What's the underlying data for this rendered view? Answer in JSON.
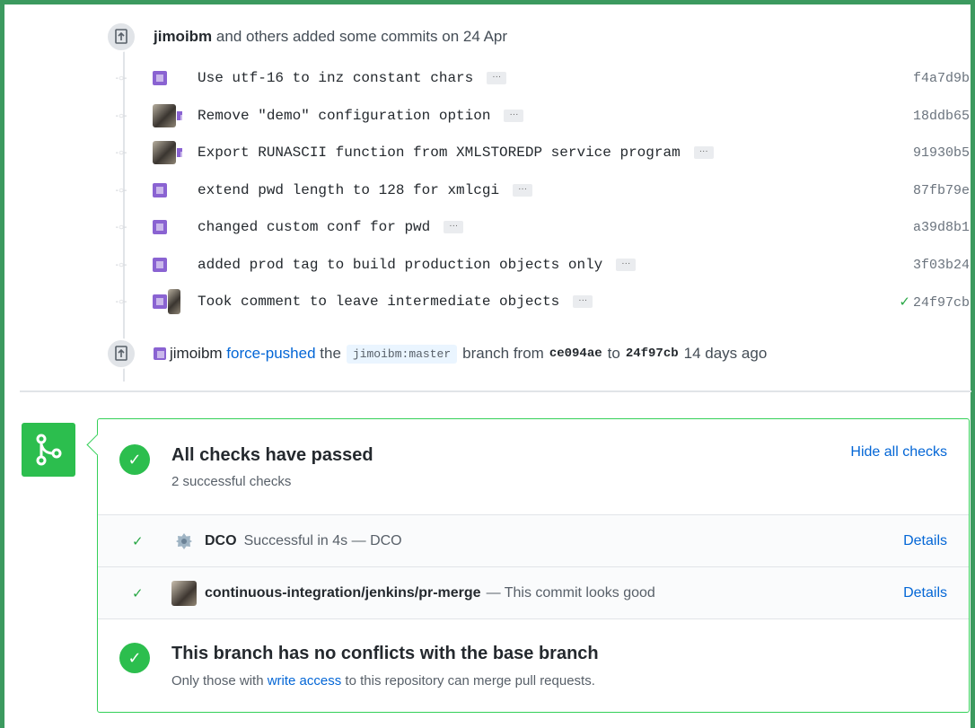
{
  "timeline": {
    "commits_event": {
      "author": "jimoibm",
      "rest": "and others added some commits on 24 Apr"
    },
    "commits": [
      {
        "message": "Use utf-16 to inz constant chars",
        "sha": "f4a7d9b",
        "avatar": "bot"
      },
      {
        "message": "Remove \"demo\" configuration option",
        "sha": "18ddb65",
        "avatar": "photo-bot"
      },
      {
        "message": "Export RUNASCII function from XMLSTOREDP service program",
        "sha": "91930b5",
        "avatar": "photo-bot"
      },
      {
        "message": "extend pwd length to 128 for xmlcgi",
        "sha": "87fb79e",
        "avatar": "bot"
      },
      {
        "message": "changed custom conf for pwd",
        "sha": "a39d8b1",
        "avatar": "bot"
      },
      {
        "message": "added prod tag to build production objects only",
        "sha": "3f03b24",
        "avatar": "bot"
      },
      {
        "message": "Took comment to leave intermediate objects",
        "sha": "24f97cb",
        "avatar": "bot-photo",
        "status": "✓"
      }
    ],
    "ellipsis_label": "···",
    "force_push": {
      "actor": "jimoibm",
      "action": "force-pushed",
      "the": "the",
      "branch_ref": "jimoibm:master",
      "branch_from": "branch from",
      "from_sha": "ce094ae",
      "to": "to",
      "to_sha": "24f97cb",
      "when": "14 days ago"
    }
  },
  "merge_box": {
    "checks_title": "All checks have passed",
    "checks_subtitle": "2 successful checks",
    "hide_link": "Hide all checks",
    "checks": [
      {
        "name": "DCO",
        "description": "Successful in 4s — DCO",
        "details": "Details",
        "icon": "dco-gear-icon"
      },
      {
        "name": "continuous-integration/jenkins/pr-merge",
        "description": "— This commit looks good",
        "details": "Details",
        "icon": "jenkins-avatar"
      }
    ],
    "conflict_title": "This branch has no conflicts with the base branch",
    "conflict_text_before": "Only those with",
    "conflict_link": "write access",
    "conflict_text_after": "to this repository can merge pull requests."
  },
  "colors": {
    "frame": "#3c9a5f",
    "success": "#2cbe4e",
    "link": "#0366d6",
    "bot_avatar": "#8a63d2"
  }
}
